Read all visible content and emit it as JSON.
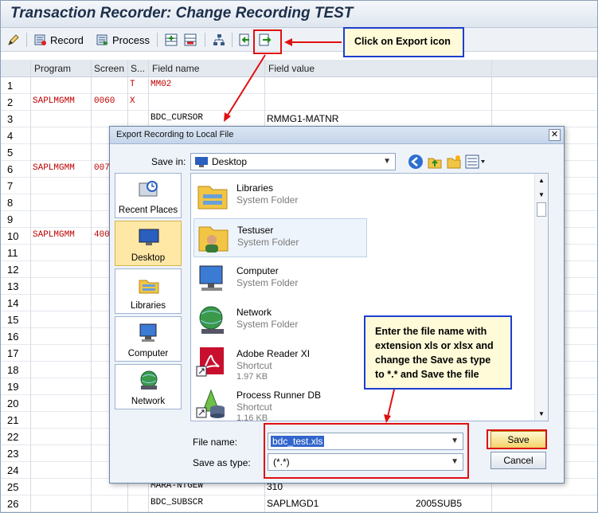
{
  "window": {
    "title": "Transaction Recorder: Change Recording TEST"
  },
  "toolbar": {
    "record_label": "Record",
    "process_label": "Process"
  },
  "grid": {
    "columns": [
      "Program",
      "Screen",
      "S...",
      "Field name",
      "Field value"
    ],
    "rows": [
      {
        "n": "1",
        "program": "",
        "screen": "",
        "s": "T",
        "field": "MM02",
        "value": "",
        "extra": ""
      },
      {
        "n": "2",
        "program": "SAPLMGMM",
        "screen": "0060",
        "s": "X",
        "field": "",
        "value": "",
        "extra": ""
      },
      {
        "n": "3",
        "program": "",
        "screen": "",
        "s": "",
        "field": "BDC_CURSOR",
        "value": "RMMG1-MATNR",
        "extra": ""
      },
      {
        "n": "4",
        "program": "",
        "screen": "",
        "s": "",
        "field": "",
        "value": "",
        "extra": ""
      },
      {
        "n": "5",
        "program": "",
        "screen": "",
        "s": "",
        "field": "",
        "value": "",
        "extra": ""
      },
      {
        "n": "6",
        "program": "SAPLMGMM",
        "screen": "007",
        "s": "",
        "field": "",
        "value": "",
        "extra": ""
      },
      {
        "n": "7",
        "program": "",
        "screen": "",
        "s": "",
        "field": "",
        "value": "",
        "extra": ""
      },
      {
        "n": "8",
        "program": "",
        "screen": "",
        "s": "",
        "field": "",
        "value": "",
        "extra": ""
      },
      {
        "n": "9",
        "program": "",
        "screen": "",
        "s": "",
        "field": "",
        "value": "",
        "extra": ""
      },
      {
        "n": "10",
        "program": "SAPLMGMM",
        "screen": "400",
        "s": "",
        "field": "",
        "value": "",
        "extra": ""
      },
      {
        "n": "11",
        "program": "",
        "screen": "",
        "s": "",
        "field": "",
        "value": "",
        "extra": ""
      },
      {
        "n": "12",
        "program": "",
        "screen": "",
        "s": "",
        "field": "",
        "value": "",
        "extra": ""
      },
      {
        "n": "13",
        "program": "",
        "screen": "",
        "s": "",
        "field": "",
        "value": "",
        "extra": ""
      },
      {
        "n": "14",
        "program": "",
        "screen": "",
        "s": "",
        "field": "",
        "value": "",
        "extra": ""
      },
      {
        "n": "15",
        "program": "",
        "screen": "",
        "s": "",
        "field": "",
        "value": "",
        "extra": ""
      },
      {
        "n": "16",
        "program": "",
        "screen": "",
        "s": "",
        "field": "",
        "value": "",
        "extra": ""
      },
      {
        "n": "17",
        "program": "",
        "screen": "",
        "s": "",
        "field": "",
        "value": "",
        "extra": ""
      },
      {
        "n": "18",
        "program": "",
        "screen": "",
        "s": "",
        "field": "",
        "value": "",
        "extra": ""
      },
      {
        "n": "19",
        "program": "",
        "screen": "",
        "s": "",
        "field": "",
        "value": "",
        "extra": ""
      },
      {
        "n": "20",
        "program": "",
        "screen": "",
        "s": "",
        "field": "",
        "value": "",
        "extra": ""
      },
      {
        "n": "21",
        "program": "",
        "screen": "",
        "s": "",
        "field": "",
        "value": "",
        "extra": ""
      },
      {
        "n": "22",
        "program": "",
        "screen": "",
        "s": "",
        "field": "",
        "value": "",
        "extra": ""
      },
      {
        "n": "23",
        "program": "",
        "screen": "",
        "s": "",
        "field": "",
        "value": "",
        "extra": ""
      },
      {
        "n": "24",
        "program": "",
        "screen": "",
        "s": "",
        "field": "",
        "value": "",
        "extra": ""
      },
      {
        "n": "25",
        "program": "",
        "screen": "",
        "s": "",
        "field": "MARA-NTGEW",
        "value": "310",
        "extra": ""
      },
      {
        "n": "26",
        "program": "",
        "screen": "",
        "s": "",
        "field": "BDC_SUBSCR",
        "value": "SAPLMGD1",
        "extra": "2005SUB5"
      }
    ]
  },
  "dialog": {
    "title": "Export Recording to Local File",
    "save_in_label": "Save in:",
    "save_in_value": "Desktop",
    "places": [
      "Recent Places",
      "Desktop",
      "Libraries",
      "Computer",
      "Network"
    ],
    "files": [
      {
        "name": "Libraries",
        "type": "System Folder",
        "size": ""
      },
      {
        "name": "Testuser",
        "type": "System Folder",
        "size": ""
      },
      {
        "name": "Computer",
        "type": "System Folder",
        "size": ""
      },
      {
        "name": "Network",
        "type": "System Folder",
        "size": ""
      },
      {
        "name": "Adobe Reader XI",
        "type": "Shortcut",
        "size": "1.97 KB"
      },
      {
        "name": "Process Runner DB",
        "type": "Shortcut",
        "size": "1.16 KB"
      }
    ],
    "file_name_label": "File name:",
    "file_name_value": "bdc_test.xls",
    "save_type_label": "Save as type:",
    "save_type_value": "(*.*)",
    "save_button": "Save",
    "cancel_button": "Cancel"
  },
  "callouts": {
    "export": "Click on Export icon",
    "filename": "Enter the file name with extension xls or xlsx and change the Save as type to *.* and Save the file"
  },
  "colors": {
    "program_text": "#c00000",
    "callout_border": "#1c3fd0",
    "highlight_box": "#e01010",
    "selected_place": "#ffe8a6"
  }
}
